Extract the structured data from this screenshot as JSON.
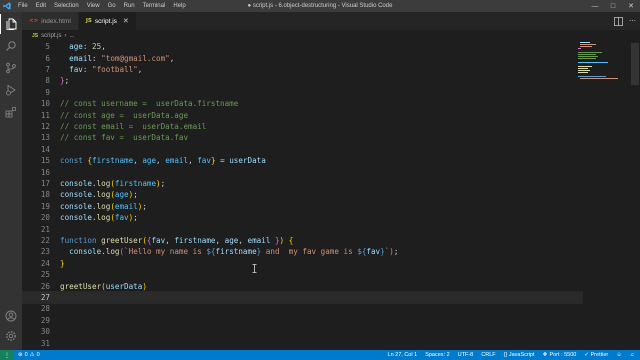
{
  "titlebar": {
    "menu": [
      "File",
      "Edit",
      "Selection",
      "View",
      "Go",
      "Run",
      "Terminal",
      "Help"
    ],
    "window_title": "● script.js - 6.object-destructuring - Visual Studio Code"
  },
  "tabs": [
    {
      "label": "index.html",
      "icon": "html-icon",
      "active": false
    },
    {
      "label": "script.js",
      "icon": "js-icon",
      "active": true
    }
  ],
  "breadcrumb": {
    "file": "script.js",
    "rest": "..."
  },
  "editor": {
    "current_line": 27,
    "lines": [
      {
        "n": "5",
        "tokens": [
          [
            "  ",
            "pun"
          ],
          [
            "age",
            "key"
          ],
          [
            ": ",
            "pun"
          ],
          [
            "25",
            "num"
          ],
          [
            ",",
            "pun"
          ]
        ]
      },
      {
        "n": "6",
        "tokens": [
          [
            "  ",
            "pun"
          ],
          [
            "email",
            "key"
          ],
          [
            ": ",
            "pun"
          ],
          [
            "\"tom@gmail.com\"",
            "str"
          ],
          [
            ",",
            "pun"
          ]
        ]
      },
      {
        "n": "7",
        "tokens": [
          [
            "  ",
            "pun"
          ],
          [
            "fav",
            "key"
          ],
          [
            ": ",
            "pun"
          ],
          [
            "\"football\"",
            "str"
          ],
          [
            ",",
            "pun"
          ]
        ]
      },
      {
        "n": "8",
        "tokens": [
          [
            "}",
            "brk"
          ],
          [
            ";",
            "pun"
          ]
        ]
      },
      {
        "n": "9",
        "tokens": []
      },
      {
        "n": "10",
        "tokens": [
          [
            "// const username =  userData.firstname",
            "com"
          ]
        ]
      },
      {
        "n": "11",
        "tokens": [
          [
            "// const age =  userData.age",
            "com"
          ]
        ]
      },
      {
        "n": "12",
        "tokens": [
          [
            "// const email =  userData.email",
            "com"
          ]
        ]
      },
      {
        "n": "13",
        "tokens": [
          [
            "// const fav =  userData.fav",
            "com"
          ]
        ]
      },
      {
        "n": "14",
        "tokens": []
      },
      {
        "n": "15",
        "tokens": [
          [
            "const ",
            "kw"
          ],
          [
            "{",
            "brk2"
          ],
          [
            "firstname",
            "cst"
          ],
          [
            ", ",
            "pun"
          ],
          [
            "age",
            "cst"
          ],
          [
            ", ",
            "pun"
          ],
          [
            "email",
            "cst"
          ],
          [
            ", ",
            "pun"
          ],
          [
            "fav",
            "cst"
          ],
          [
            "}",
            "brk2"
          ],
          [
            " = ",
            "pun"
          ],
          [
            "userData",
            "var"
          ]
        ]
      },
      {
        "n": "16",
        "tokens": []
      },
      {
        "n": "17",
        "tokens": [
          [
            "console",
            "var"
          ],
          [
            ".",
            "pun"
          ],
          [
            "log",
            "fn"
          ],
          [
            "(",
            "brk2"
          ],
          [
            "firstname",
            "cst"
          ],
          [
            ")",
            "brk2"
          ],
          [
            ";",
            "pun"
          ]
        ]
      },
      {
        "n": "18",
        "tokens": [
          [
            "console",
            "var"
          ],
          [
            ".",
            "pun"
          ],
          [
            "log",
            "fn"
          ],
          [
            "(",
            "brk2"
          ],
          [
            "age",
            "cst"
          ],
          [
            ")",
            "brk2"
          ],
          [
            ";",
            "pun"
          ]
        ]
      },
      {
        "n": "19",
        "tokens": [
          [
            "console",
            "var"
          ],
          [
            ".",
            "pun"
          ],
          [
            "log",
            "fn"
          ],
          [
            "(",
            "brk2"
          ],
          [
            "email",
            "cst"
          ],
          [
            ")",
            "brk2"
          ],
          [
            ";",
            "pun"
          ]
        ]
      },
      {
        "n": "20",
        "tokens": [
          [
            "console",
            "var"
          ],
          [
            ".",
            "pun"
          ],
          [
            "log",
            "fn"
          ],
          [
            "(",
            "brk2"
          ],
          [
            "fav",
            "cst"
          ],
          [
            ")",
            "brk2"
          ],
          [
            ";",
            "pun"
          ]
        ]
      },
      {
        "n": "21",
        "tokens": []
      },
      {
        "n": "22",
        "tokens": [
          [
            "function ",
            "kw"
          ],
          [
            "greetUser",
            "fn"
          ],
          [
            "(",
            "brk2"
          ],
          [
            "{",
            "brk"
          ],
          [
            "fav",
            "var"
          ],
          [
            ", ",
            "pun"
          ],
          [
            "firstname",
            "var"
          ],
          [
            ", ",
            "pun"
          ],
          [
            "age",
            "var"
          ],
          [
            ", ",
            "pun"
          ],
          [
            "email ",
            "var"
          ],
          [
            "}",
            "brk"
          ],
          [
            ")",
            "brk2"
          ],
          [
            " ",
            "pun"
          ],
          [
            "{",
            "brk2"
          ]
        ]
      },
      {
        "n": "23",
        "tokens": [
          [
            "  ",
            "pun"
          ],
          [
            "console",
            "var"
          ],
          [
            ".",
            "pun"
          ],
          [
            "log",
            "fn"
          ],
          [
            "(",
            "brk"
          ],
          [
            "`Hello my name is ",
            "str"
          ],
          [
            "${",
            "kw"
          ],
          [
            "firstname",
            "var"
          ],
          [
            "}",
            "kw"
          ],
          [
            " and  my fav game is ",
            "str"
          ],
          [
            "${",
            "kw"
          ],
          [
            "fav",
            "var"
          ],
          [
            "}",
            "kw"
          ],
          [
            "`",
            "str"
          ],
          [
            ")",
            "brk"
          ],
          [
            ";",
            "pun"
          ]
        ]
      },
      {
        "n": "24",
        "tokens": [
          [
            "}",
            "brk2"
          ]
        ]
      },
      {
        "n": "25",
        "tokens": []
      },
      {
        "n": "26",
        "tokens": [
          [
            "greetUser",
            "fn"
          ],
          [
            "(",
            "brk2"
          ],
          [
            "userData",
            "var"
          ],
          [
            ")",
            "brk2"
          ]
        ]
      },
      {
        "n": "27",
        "tokens": []
      },
      {
        "n": "28",
        "tokens": []
      },
      {
        "n": "29",
        "tokens": []
      },
      {
        "n": "30",
        "tokens": []
      },
      {
        "n": "31",
        "tokens": []
      }
    ]
  },
  "statusbar": {
    "errors": "0",
    "warnings": "0",
    "position": "Ln 27, Col 1",
    "spaces": "Spaces: 2",
    "encoding": "UTF-8",
    "eol": "CRLF",
    "language": "{} JavaScript",
    "port": "Port : 5500",
    "prettier": "✓ Prettier"
  },
  "colors": {
    "titlebar": "#3c3c3c",
    "activitybar": "#333333",
    "editor_bg": "#1e1e1e",
    "statusbar": "#007acc"
  }
}
